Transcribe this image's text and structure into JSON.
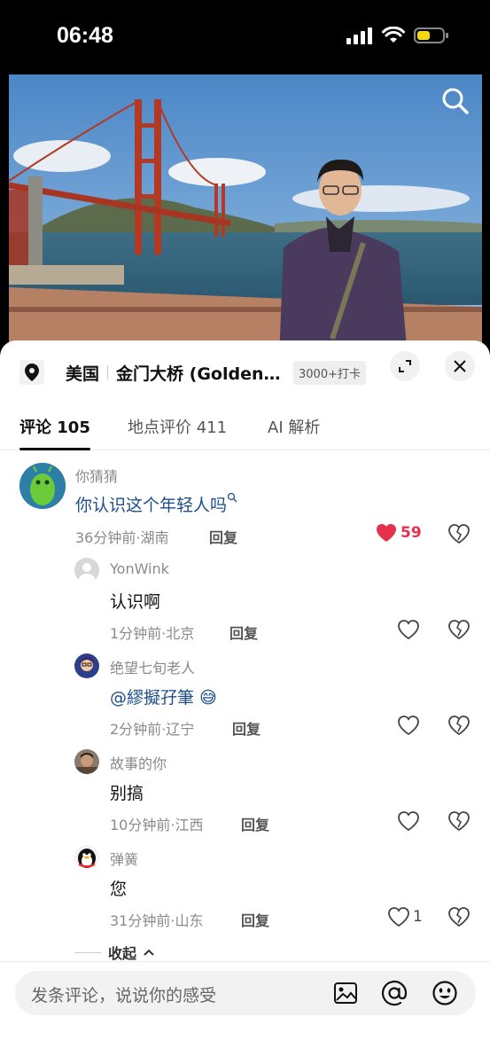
{
  "status": {
    "time": "06:48"
  },
  "location": {
    "country": "美国",
    "name": "金门大桥 (Golden...",
    "badge": "3000+打卡"
  },
  "tabs": [
    {
      "label": "评论 105",
      "active": true
    },
    {
      "label": "地点评价 411",
      "active": false
    },
    {
      "label": "AI 解析",
      "active": false
    }
  ],
  "comments": [
    {
      "author": "你猜猜",
      "text": "你认识这个年轻人吗",
      "text_is_link": true,
      "time_loc": "36分钟前·湖南",
      "reply": "回复",
      "likes": "59",
      "liked": true
    },
    {
      "author": "YonWink",
      "text": "认识啊",
      "time_loc": "1分钟前·北京",
      "reply": "回复",
      "likes": "",
      "liked": false
    },
    {
      "author": "绝望七旬老人",
      "text": "@繆擬孖筆 😅",
      "text_is_link": true,
      "time_loc": "2分钟前·辽宁",
      "reply": "回复",
      "likes": "",
      "liked": false
    },
    {
      "author": "故事的你",
      "text": "别搞",
      "time_loc": "10分钟前·江西",
      "reply": "回复",
      "likes": "",
      "liked": false
    },
    {
      "author": "弹簧",
      "text": "您",
      "time_loc": "31分钟前·山东",
      "reply": "回复",
      "likes": "1",
      "liked": false
    }
  ],
  "collapse": "收起",
  "input": {
    "placeholder": "发条评论，说说你的感受"
  },
  "colors": {
    "like_red": "#e5314b",
    "link_blue": "#1d4e89"
  },
  "icons": [
    "search-icon",
    "location-pin-icon",
    "expand-icon",
    "close-icon",
    "heart-icon",
    "dislike-heart-icon",
    "image-icon",
    "at-icon",
    "emoji-icon"
  ]
}
